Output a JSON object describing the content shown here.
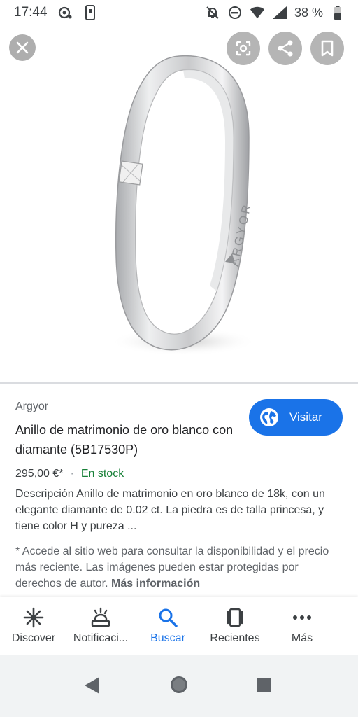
{
  "status_bar": {
    "time": "17:44",
    "battery": "38 %"
  },
  "image": {
    "brand_engraving": "ARGYOR"
  },
  "product": {
    "source": "Argyor",
    "title": "Anillo de matrimonio de oro blanco con diamante (5B17530P)",
    "visit_label": "Visitar",
    "price": "295,00 €*",
    "separator": "·",
    "stock": "En stock",
    "description": "Descripción Anillo de matrimonio en oro blanco de 18k, con un elegante diamante de 0.02 ct. La piedra es de talla princesa, y tiene color H y pureza ...",
    "note": "* Accede al sitio web para consultar la disponibilidad y el precio más reciente. Las imágenes pueden estar protegidas por derechos de autor.",
    "more_info": "Más información"
  },
  "bottom_nav": {
    "items": [
      {
        "label": "Discover",
        "icon": "asterisk-icon"
      },
      {
        "label": "Notificaci...",
        "icon": "bell-icon"
      },
      {
        "label": "Buscar",
        "icon": "search-icon"
      },
      {
        "label": "Recientes",
        "icon": "recent-tabs-icon"
      },
      {
        "label": "Más",
        "icon": "more-icon"
      }
    ],
    "active": "Buscar"
  },
  "colors": {
    "accent": "#1a73e8",
    "stock_green": "#188038"
  }
}
